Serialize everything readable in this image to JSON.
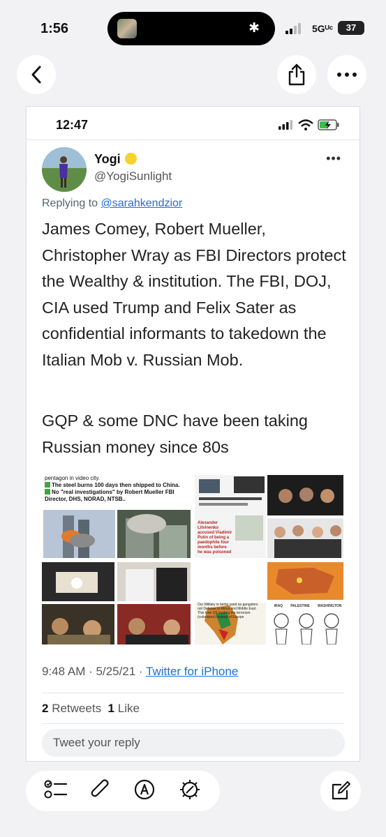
{
  "status_bar": {
    "time": "1:56",
    "network": "5Gᵁᶜ",
    "battery": "37"
  },
  "inner_status": {
    "time": "12:47"
  },
  "tweet": {
    "author_name": "Yogi",
    "author_handle": "@YogiSunlight",
    "replying_prefix": "Replying to",
    "replying_to": "@sarahkendzior",
    "text_paragraph_1": "James Comey, Robert Mueller, Christopher Wray as FBI Directors protect the Wealthy & institution. The FBI, DOJ, CIA used Trump and Felix Sater as confidential informants to takedown the Italian Mob v. Russian Mob.",
    "text_paragraph_2": "GQP & some DNC have been taking Russian money since 80s",
    "media_text": {
      "top_left_line1": "pentagon in video city.",
      "top_left_line2": "The steel burns 100 days then shipped to China.",
      "top_left_line3": "No \"real investigations\" by Robert Mueller FBI Director, DHS, NORAD, NTSB..",
      "article_headline": "Alexander Litvinenko accused Vladimir Putin of being a paedophile four months before he was poisoned",
      "bottom_left_text": "Our Military is being used as gangsters not Defense in Africa and Middle East. This time US leading the terrorism (colonizers) instead of Europe",
      "cartoon_label_1": "IRAQ",
      "cartoon_label_2": "PALESTINE",
      "cartoon_label_3": "WASHINGTON"
    },
    "timestamp": "9:48 AM · 5/25/21 ·",
    "source": "Twitter for iPhone",
    "retweets_count": "2",
    "retweets_label": "Retweets",
    "likes_count": "1",
    "likes_label": "Like",
    "reply_placeholder": "Tweet your reply"
  },
  "icons": [
    "back-arrow-icon",
    "share-icon",
    "more-icon",
    "checklist-icon",
    "paperclip-icon",
    "markup-icon",
    "magic-icon",
    "compose-icon"
  ],
  "colors": {
    "link": "#1d6fe0",
    "background": "#f2f2f4",
    "green_check": "#3ea63e"
  }
}
